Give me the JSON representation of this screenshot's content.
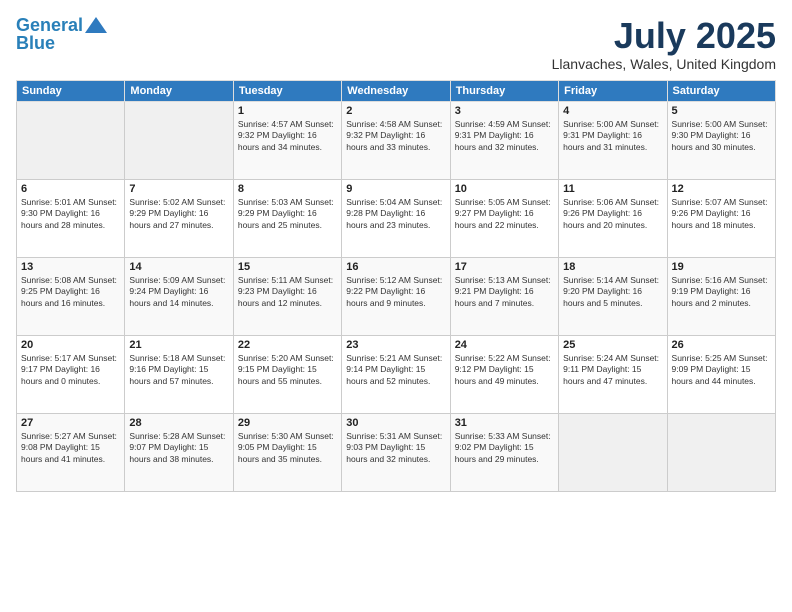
{
  "logo": {
    "line1": "General",
    "line2": "Blue"
  },
  "title": "July 2025",
  "location": "Llanvaches, Wales, United Kingdom",
  "days_of_week": [
    "Sunday",
    "Monday",
    "Tuesday",
    "Wednesday",
    "Thursday",
    "Friday",
    "Saturday"
  ],
  "weeks": [
    [
      {
        "day": "",
        "detail": ""
      },
      {
        "day": "",
        "detail": ""
      },
      {
        "day": "1",
        "detail": "Sunrise: 4:57 AM\nSunset: 9:32 PM\nDaylight: 16 hours\nand 34 minutes."
      },
      {
        "day": "2",
        "detail": "Sunrise: 4:58 AM\nSunset: 9:32 PM\nDaylight: 16 hours\nand 33 minutes."
      },
      {
        "day": "3",
        "detail": "Sunrise: 4:59 AM\nSunset: 9:31 PM\nDaylight: 16 hours\nand 32 minutes."
      },
      {
        "day": "4",
        "detail": "Sunrise: 5:00 AM\nSunset: 9:31 PM\nDaylight: 16 hours\nand 31 minutes."
      },
      {
        "day": "5",
        "detail": "Sunrise: 5:00 AM\nSunset: 9:30 PM\nDaylight: 16 hours\nand 30 minutes."
      }
    ],
    [
      {
        "day": "6",
        "detail": "Sunrise: 5:01 AM\nSunset: 9:30 PM\nDaylight: 16 hours\nand 28 minutes."
      },
      {
        "day": "7",
        "detail": "Sunrise: 5:02 AM\nSunset: 9:29 PM\nDaylight: 16 hours\nand 27 minutes."
      },
      {
        "day": "8",
        "detail": "Sunrise: 5:03 AM\nSunset: 9:29 PM\nDaylight: 16 hours\nand 25 minutes."
      },
      {
        "day": "9",
        "detail": "Sunrise: 5:04 AM\nSunset: 9:28 PM\nDaylight: 16 hours\nand 23 minutes."
      },
      {
        "day": "10",
        "detail": "Sunrise: 5:05 AM\nSunset: 9:27 PM\nDaylight: 16 hours\nand 22 minutes."
      },
      {
        "day": "11",
        "detail": "Sunrise: 5:06 AM\nSunset: 9:26 PM\nDaylight: 16 hours\nand 20 minutes."
      },
      {
        "day": "12",
        "detail": "Sunrise: 5:07 AM\nSunset: 9:26 PM\nDaylight: 16 hours\nand 18 minutes."
      }
    ],
    [
      {
        "day": "13",
        "detail": "Sunrise: 5:08 AM\nSunset: 9:25 PM\nDaylight: 16 hours\nand 16 minutes."
      },
      {
        "day": "14",
        "detail": "Sunrise: 5:09 AM\nSunset: 9:24 PM\nDaylight: 16 hours\nand 14 minutes."
      },
      {
        "day": "15",
        "detail": "Sunrise: 5:11 AM\nSunset: 9:23 PM\nDaylight: 16 hours\nand 12 minutes."
      },
      {
        "day": "16",
        "detail": "Sunrise: 5:12 AM\nSunset: 9:22 PM\nDaylight: 16 hours\nand 9 minutes."
      },
      {
        "day": "17",
        "detail": "Sunrise: 5:13 AM\nSunset: 9:21 PM\nDaylight: 16 hours\nand 7 minutes."
      },
      {
        "day": "18",
        "detail": "Sunrise: 5:14 AM\nSunset: 9:20 PM\nDaylight: 16 hours\nand 5 minutes."
      },
      {
        "day": "19",
        "detail": "Sunrise: 5:16 AM\nSunset: 9:19 PM\nDaylight: 16 hours\nand 2 minutes."
      }
    ],
    [
      {
        "day": "20",
        "detail": "Sunrise: 5:17 AM\nSunset: 9:17 PM\nDaylight: 16 hours\nand 0 minutes."
      },
      {
        "day": "21",
        "detail": "Sunrise: 5:18 AM\nSunset: 9:16 PM\nDaylight: 15 hours\nand 57 minutes."
      },
      {
        "day": "22",
        "detail": "Sunrise: 5:20 AM\nSunset: 9:15 PM\nDaylight: 15 hours\nand 55 minutes."
      },
      {
        "day": "23",
        "detail": "Sunrise: 5:21 AM\nSunset: 9:14 PM\nDaylight: 15 hours\nand 52 minutes."
      },
      {
        "day": "24",
        "detail": "Sunrise: 5:22 AM\nSunset: 9:12 PM\nDaylight: 15 hours\nand 49 minutes."
      },
      {
        "day": "25",
        "detail": "Sunrise: 5:24 AM\nSunset: 9:11 PM\nDaylight: 15 hours\nand 47 minutes."
      },
      {
        "day": "26",
        "detail": "Sunrise: 5:25 AM\nSunset: 9:09 PM\nDaylight: 15 hours\nand 44 minutes."
      }
    ],
    [
      {
        "day": "27",
        "detail": "Sunrise: 5:27 AM\nSunset: 9:08 PM\nDaylight: 15 hours\nand 41 minutes."
      },
      {
        "day": "28",
        "detail": "Sunrise: 5:28 AM\nSunset: 9:07 PM\nDaylight: 15 hours\nand 38 minutes."
      },
      {
        "day": "29",
        "detail": "Sunrise: 5:30 AM\nSunset: 9:05 PM\nDaylight: 15 hours\nand 35 minutes."
      },
      {
        "day": "30",
        "detail": "Sunrise: 5:31 AM\nSunset: 9:03 PM\nDaylight: 15 hours\nand 32 minutes."
      },
      {
        "day": "31",
        "detail": "Sunrise: 5:33 AM\nSunset: 9:02 PM\nDaylight: 15 hours\nand 29 minutes."
      },
      {
        "day": "",
        "detail": ""
      },
      {
        "day": "",
        "detail": ""
      }
    ]
  ]
}
